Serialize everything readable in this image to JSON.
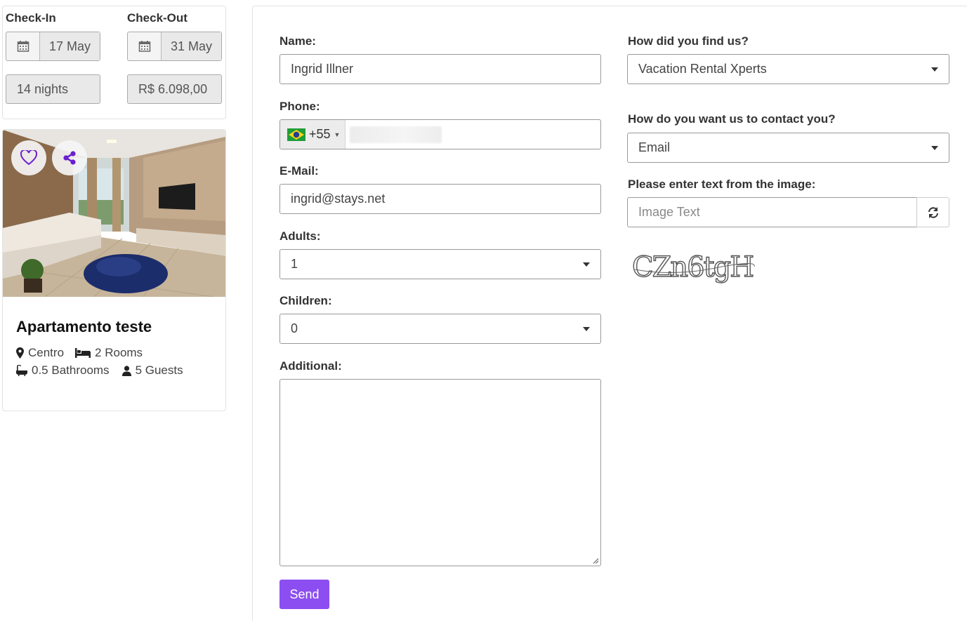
{
  "booking": {
    "checkin_label": "Check-In",
    "checkout_label": "Check-Out",
    "checkin_date": "17 May",
    "checkout_date": "31 May",
    "nights": "14 nights",
    "price": "R$ 6.098,00"
  },
  "property": {
    "title": "Apartamento teste",
    "location": "Centro",
    "rooms": "2 Rooms",
    "bathrooms": "0.5 Bathrooms",
    "guests": "5 Guests"
  },
  "form": {
    "name_label": "Name:",
    "name_value": "Ingrid Illner",
    "phone_label": "Phone:",
    "phone_code": "+55",
    "email_label": "E-Mail:",
    "email_value": "ingrid@stays.net",
    "adults_label": "Adults:",
    "adults_value": "1",
    "children_label": "Children:",
    "children_value": "0",
    "additional_label": "Additional:",
    "send_label": "Send",
    "found_label": "How did you find us?",
    "found_value": "Vacation Rental Xperts",
    "contact_label": "How do you want us to contact you?",
    "contact_value": "Email",
    "captcha_label": "Please enter text from the image:",
    "captcha_placeholder": "Image Text",
    "captcha_text": "CZn6tgH"
  },
  "colors": {
    "accent": "#8c4ef0",
    "icon_purple": "#6a1fd0"
  }
}
